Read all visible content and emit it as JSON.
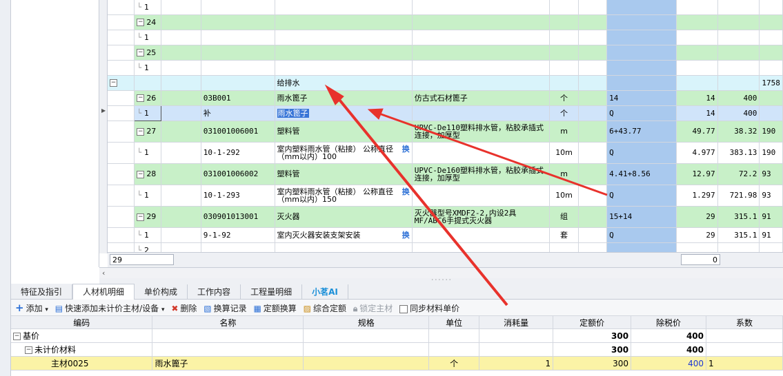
{
  "grid": {
    "rows": [
      {
        "kind": "sub",
        "seq": "1",
        "code": "",
        "name": "",
        "feature": "",
        "unit": "",
        "qexpr": "",
        "qty": "",
        "price": "",
        "total": ""
      },
      {
        "kind": "item",
        "seq": "24",
        "code": "",
        "name": "",
        "feature": "",
        "unit": "",
        "qexpr": "",
        "qty": "",
        "price": "",
        "total": ""
      },
      {
        "kind": "sub",
        "seq": "1",
        "code": "",
        "name": "",
        "feature": "",
        "unit": "",
        "qexpr": "",
        "qty": "",
        "price": "",
        "total": ""
      },
      {
        "kind": "item",
        "seq": "25",
        "code": "",
        "name": "",
        "feature": "",
        "unit": "",
        "qexpr": "",
        "qty": "",
        "price": "",
        "total": ""
      },
      {
        "kind": "sub",
        "seq": "1",
        "code": "",
        "name": "",
        "feature": "",
        "unit": "",
        "qexpr": "",
        "qty": "",
        "price": "",
        "total": ""
      },
      {
        "kind": "section",
        "seq": "",
        "code": "",
        "name": "给排水",
        "feature": "",
        "unit": "",
        "qexpr": "",
        "qty": "",
        "price": "",
        "total": "1758"
      },
      {
        "kind": "item",
        "seq": "26",
        "code": "03B001",
        "name": "雨水篦子",
        "feature": "仿古式石材篦子",
        "unit": "个",
        "qexpr": "14",
        "qty": "14",
        "price": "400",
        "total": ""
      },
      {
        "kind": "subsel",
        "seq": "1",
        "code": "补",
        "name": "雨水篦子",
        "feature": "",
        "unit": "个",
        "qexpr": "Q",
        "qty": "14",
        "price": "400",
        "total": ""
      },
      {
        "kind": "item",
        "seq": "27",
        "code": "031001006001",
        "name": "塑料管",
        "feature": "UPVC-De110塑料排水管，粘胶承插式连接，加厚型",
        "unit": "m",
        "qexpr": "6+43.77",
        "qty": "49.77",
        "price": "38.32",
        "total": "190"
      },
      {
        "kind": "sub",
        "seq": "1",
        "code": "10-1-292",
        "swap": "换",
        "name": "室内塑料雨水管（粘接） 公称直径（mm以内）100",
        "feature": "",
        "unit": "10m",
        "qexpr": "Q",
        "qty": "4.977",
        "price": "383.13",
        "total": "190"
      },
      {
        "kind": "item",
        "seq": "28",
        "code": "031001006002",
        "name": "塑料管",
        "feature": "UPVC-De160塑料排水管，粘胶承插式连接，加厚型",
        "unit": "m",
        "qexpr": "4.41+8.56",
        "qty": "12.97",
        "price": "72.2",
        "total": "93"
      },
      {
        "kind": "sub",
        "seq": "1",
        "code": "10-1-293",
        "swap": "换",
        "name": "室内塑料雨水管（粘接） 公称直径（mm以内）150",
        "feature": "",
        "unit": "10m",
        "qexpr": "Q",
        "qty": "1.297",
        "price": "721.98",
        "total": "93"
      },
      {
        "kind": "item",
        "seq": "29",
        "code": "030901013001",
        "name": "灭火器",
        "feature": "灭火器型号XMDF2-2,内设2具MF/ABC6手提式灭火器",
        "unit": "组",
        "qexpr": "15+14",
        "qty": "29",
        "price": "315.1",
        "total": "91"
      },
      {
        "kind": "sub",
        "seq": "1",
        "code": "9-1-92",
        "swap": "换",
        "name": "室内灭火器安装支架安装",
        "feature": "",
        "unit": "套",
        "qexpr": "Q",
        "qty": "29",
        "price": "315.1",
        "total": "91"
      },
      {
        "kind": "sub",
        "seq": "2",
        "code": "",
        "name": "",
        "feature": "",
        "unit": "",
        "qexpr": "",
        "qty": "",
        "price": "",
        "total": ""
      }
    ],
    "footer": {
      "count": "29",
      "value": "0"
    }
  },
  "tabs": [
    "特征及指引",
    "人材机明细",
    "单价构成",
    "工作内容",
    "工程量明细",
    "小茗AI"
  ],
  "toolbar": {
    "add": "添加",
    "quick_add": "快速添加未计价主材/设备",
    "delete": "删除",
    "calc_record": "换算记录",
    "quota_convert": "定额换算",
    "comprehensive": "综合定额",
    "lock_material": "锁定主材",
    "sync_price": "同步材料单价"
  },
  "bottom": {
    "headers": [
      "编码",
      "名称",
      "规格",
      "单位",
      "消耗量",
      "定额价",
      "除税价",
      "系数"
    ],
    "rows": [
      {
        "code": "基价",
        "name": "",
        "spec": "",
        "unit": "",
        "consume": "",
        "quota": "300",
        "tax": "400",
        "coef": ""
      },
      {
        "code": "未计价材料",
        "name": "",
        "spec": "",
        "unit": "",
        "consume": "",
        "quota": "300",
        "tax": "400",
        "coef": ""
      },
      {
        "code": "主材0025",
        "name": "雨水篦子",
        "spec": "",
        "unit": "个",
        "consume": "1",
        "quota": "300",
        "tax": "400",
        "coef": "1"
      }
    ]
  },
  "colors": {
    "green": "#c8f0c8",
    "blue": "#a9c9ee",
    "section": "#d9f4fb",
    "arrow": "#e8322c",
    "highlight": "#fbf3a6"
  }
}
